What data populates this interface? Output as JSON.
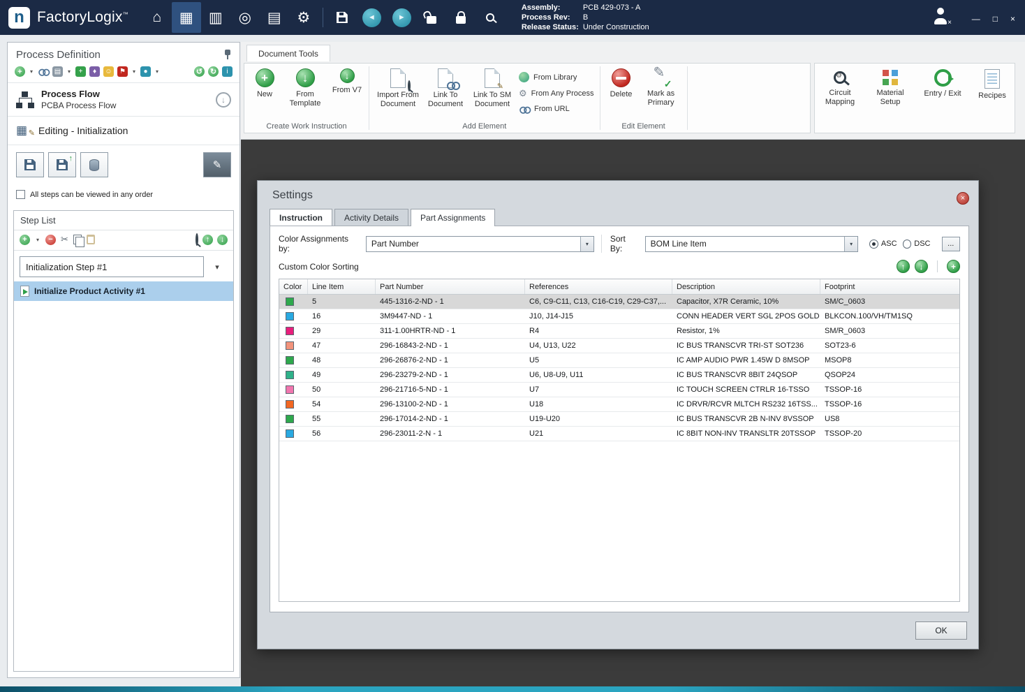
{
  "icons": {
    "home": "⌂",
    "form": "▦",
    "layers": "▥",
    "navigator": "◎",
    "reports": "▤",
    "gear": "⚙",
    "back": "◄",
    "forward": "►",
    "chevron_down": "▾",
    "plus": "+",
    "minus": "−",
    "up": "↑",
    "down": "↓",
    "check": "✓",
    "pencil": "✎",
    "scissors": "✂",
    "close": "×",
    "minimize": "—",
    "maximize": "□",
    "smiley": "☺",
    "flag": "⚑",
    "diamond": "♦",
    "dot": "●",
    "undo": "↺",
    "redo": "↻"
  },
  "titlebar": {
    "logo_letter": "n",
    "app_name": "FactoryLogix",
    "trademark": "™",
    "assembly_label": "Assembly:",
    "assembly_value": "PCB 429-073 - A",
    "process_rev_label": "Process Rev:",
    "process_rev_value": "B",
    "release_status_label": "Release Status:",
    "release_status_value": "Under Construction"
  },
  "sidebar": {
    "title": "Process Definition",
    "process_flow_title": "Process Flow",
    "process_flow_subtitle": "PCBA Process Flow",
    "editing_header": "Editing - Initialization",
    "order_checkbox_label": "All steps can be viewed in any order",
    "order_checkbox_checked": false,
    "step_list_title": "Step List",
    "step_name": "Initialization Step #1",
    "activity_name": "Initialize Product Activity #1"
  },
  "ribbon": {
    "tab_label": "Document Tools",
    "create_group_label": "Create Work Instruction",
    "new_label": "New",
    "from_template_label": "From Template",
    "from_v7_label": "From V7",
    "add_group_label": "Add Element",
    "import_from_document_label": "Import From Document",
    "link_to_document_label": "Link To Document",
    "link_to_sm_document_label": "Link To SM Document",
    "from_library_label": "From Library",
    "from_any_process_label": "From Any Process",
    "from_url_label": "From URL",
    "edit_group_label": "Edit Element",
    "delete_label": "Delete",
    "mark_as_primary_label": "Mark as Primary",
    "circuit_mapping_label": "Circuit Mapping",
    "material_setup_label": "Material Setup",
    "entry_exit_label": "Entry / Exit",
    "recipes_label": "Recipes"
  },
  "settings": {
    "title": "Settings",
    "tabs": [
      {
        "label": "Instruction"
      },
      {
        "label": "Activity Details"
      },
      {
        "label": "Part Assignments"
      }
    ],
    "active_tab": "Part Assignments",
    "color_assignments_label": "Color Assignments by:",
    "color_assignments_value": "Part Number",
    "sort_by_label": "Sort By:",
    "sort_by_value": "BOM Line Item",
    "sort_direction": "ASC",
    "asc_label": "ASC",
    "dsc_label": "DSC",
    "more_button_label": "...",
    "custom_color_sorting_label": "Custom Color Sorting",
    "ok_label": "OK",
    "table": {
      "columns": [
        "Color",
        "Line Item",
        "Part Number",
        "References",
        "Description",
        "Footprint"
      ],
      "selected_row_index": 0,
      "rows": [
        {
          "color": "#2EA84C",
          "line_item": "5",
          "part_number": "445-1316-2-ND - 1",
          "references": "C6, C9-C11, C13, C16-C19, C29-C37,...",
          "description": "Capacitor,  X7R Ceramic, 10%",
          "footprint": "SM/C_0603"
        },
        {
          "color": "#29A9E1",
          "line_item": "16",
          "part_number": "3M9447-ND - 1",
          "references": "J10, J14-J15",
          "description": "CONN HEADER VERT SGL 2POS GOLD",
          "footprint": "BLKCON.100/VH/TM1SQ"
        },
        {
          "color": "#E81E7B",
          "line_item": "29",
          "part_number": "311-1.00HRTR-ND - 1",
          "references": "R4",
          "description": "Resistor, 1%",
          "footprint": "SM/R_0603"
        },
        {
          "color": "#F2937B",
          "line_item": "47",
          "part_number": "296-16843-2-ND - 1",
          "references": "U4, U13, U22",
          "description": "IC BUS TRANSCVR TRI-ST SOT236",
          "footprint": "SOT23-6"
        },
        {
          "color": "#2EA84C",
          "line_item": "48",
          "part_number": "296-26876-2-ND - 1",
          "references": "U5",
          "description": "IC AMP AUDIO PWR 1.45W D 8MSOP",
          "footprint": "MSOP8"
        },
        {
          "color": "#2FB189",
          "line_item": "49",
          "part_number": "296-23279-2-ND - 1",
          "references": "U6, U8-U9, U11",
          "description": "IC BUS TRANSCVR 8BIT 24QSOP",
          "footprint": "QSOP24"
        },
        {
          "color": "#F176AE",
          "line_item": "50",
          "part_number": "296-21716-5-ND - 1",
          "references": "U7",
          "description": "IC TOUCH SCREEN CTRLR 16-TSSO",
          "footprint": "TSSOP-16"
        },
        {
          "color": "#F26722",
          "line_item": "54",
          "part_number": "296-13100-2-ND - 1",
          "references": "U18",
          "description": "IC DRVR/RCVR MLTCH RS232 16TSS...",
          "footprint": "TSSOP-16"
        },
        {
          "color": "#2EA84C",
          "line_item": "55",
          "part_number": "296-17014-2-ND - 1",
          "references": "U19-U20",
          "description": "IC BUS TRANSCVR 2B N-INV 8VSSOP",
          "footprint": "US8"
        },
        {
          "color": "#29A9E1",
          "line_item": "56",
          "part_number": "296-23011-2-N - 1",
          "references": "U21",
          "description": "IC 8BIT NON-INV TRANSLTR 20TSSOP",
          "footprint": "TSSOP-20"
        }
      ]
    }
  }
}
